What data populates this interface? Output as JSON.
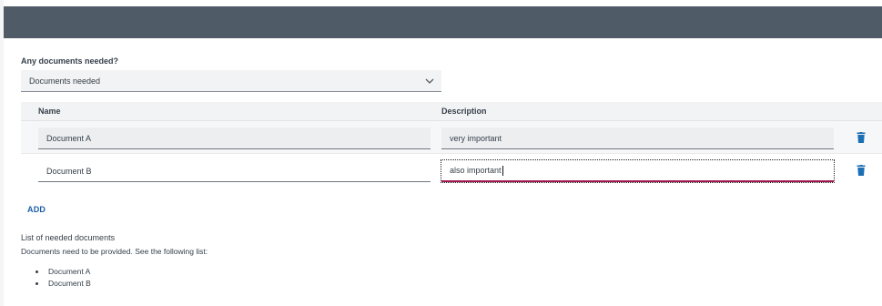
{
  "form": {
    "question_label": "Any documents needed?",
    "select": {
      "value": "Documents needed",
      "icon": "chevron-down-icon"
    }
  },
  "grid": {
    "columns": [
      "Name",
      "Description"
    ],
    "rows": [
      {
        "name": "Document A",
        "description": "very important"
      },
      {
        "name": "Document B",
        "description": "also important"
      }
    ],
    "delete_icon": "trash-icon",
    "add_label": "ADD"
  },
  "summary": {
    "title": "List of needed documents",
    "description": "Documents need to be provided. See the following list:",
    "items": [
      "Document A",
      "Document B"
    ]
  },
  "colors": {
    "topbar": "#4f5b67",
    "accent_link": "#1a5fa6",
    "focus_underline": "#a3174f",
    "delete_icon": "#1a6fb5"
  }
}
